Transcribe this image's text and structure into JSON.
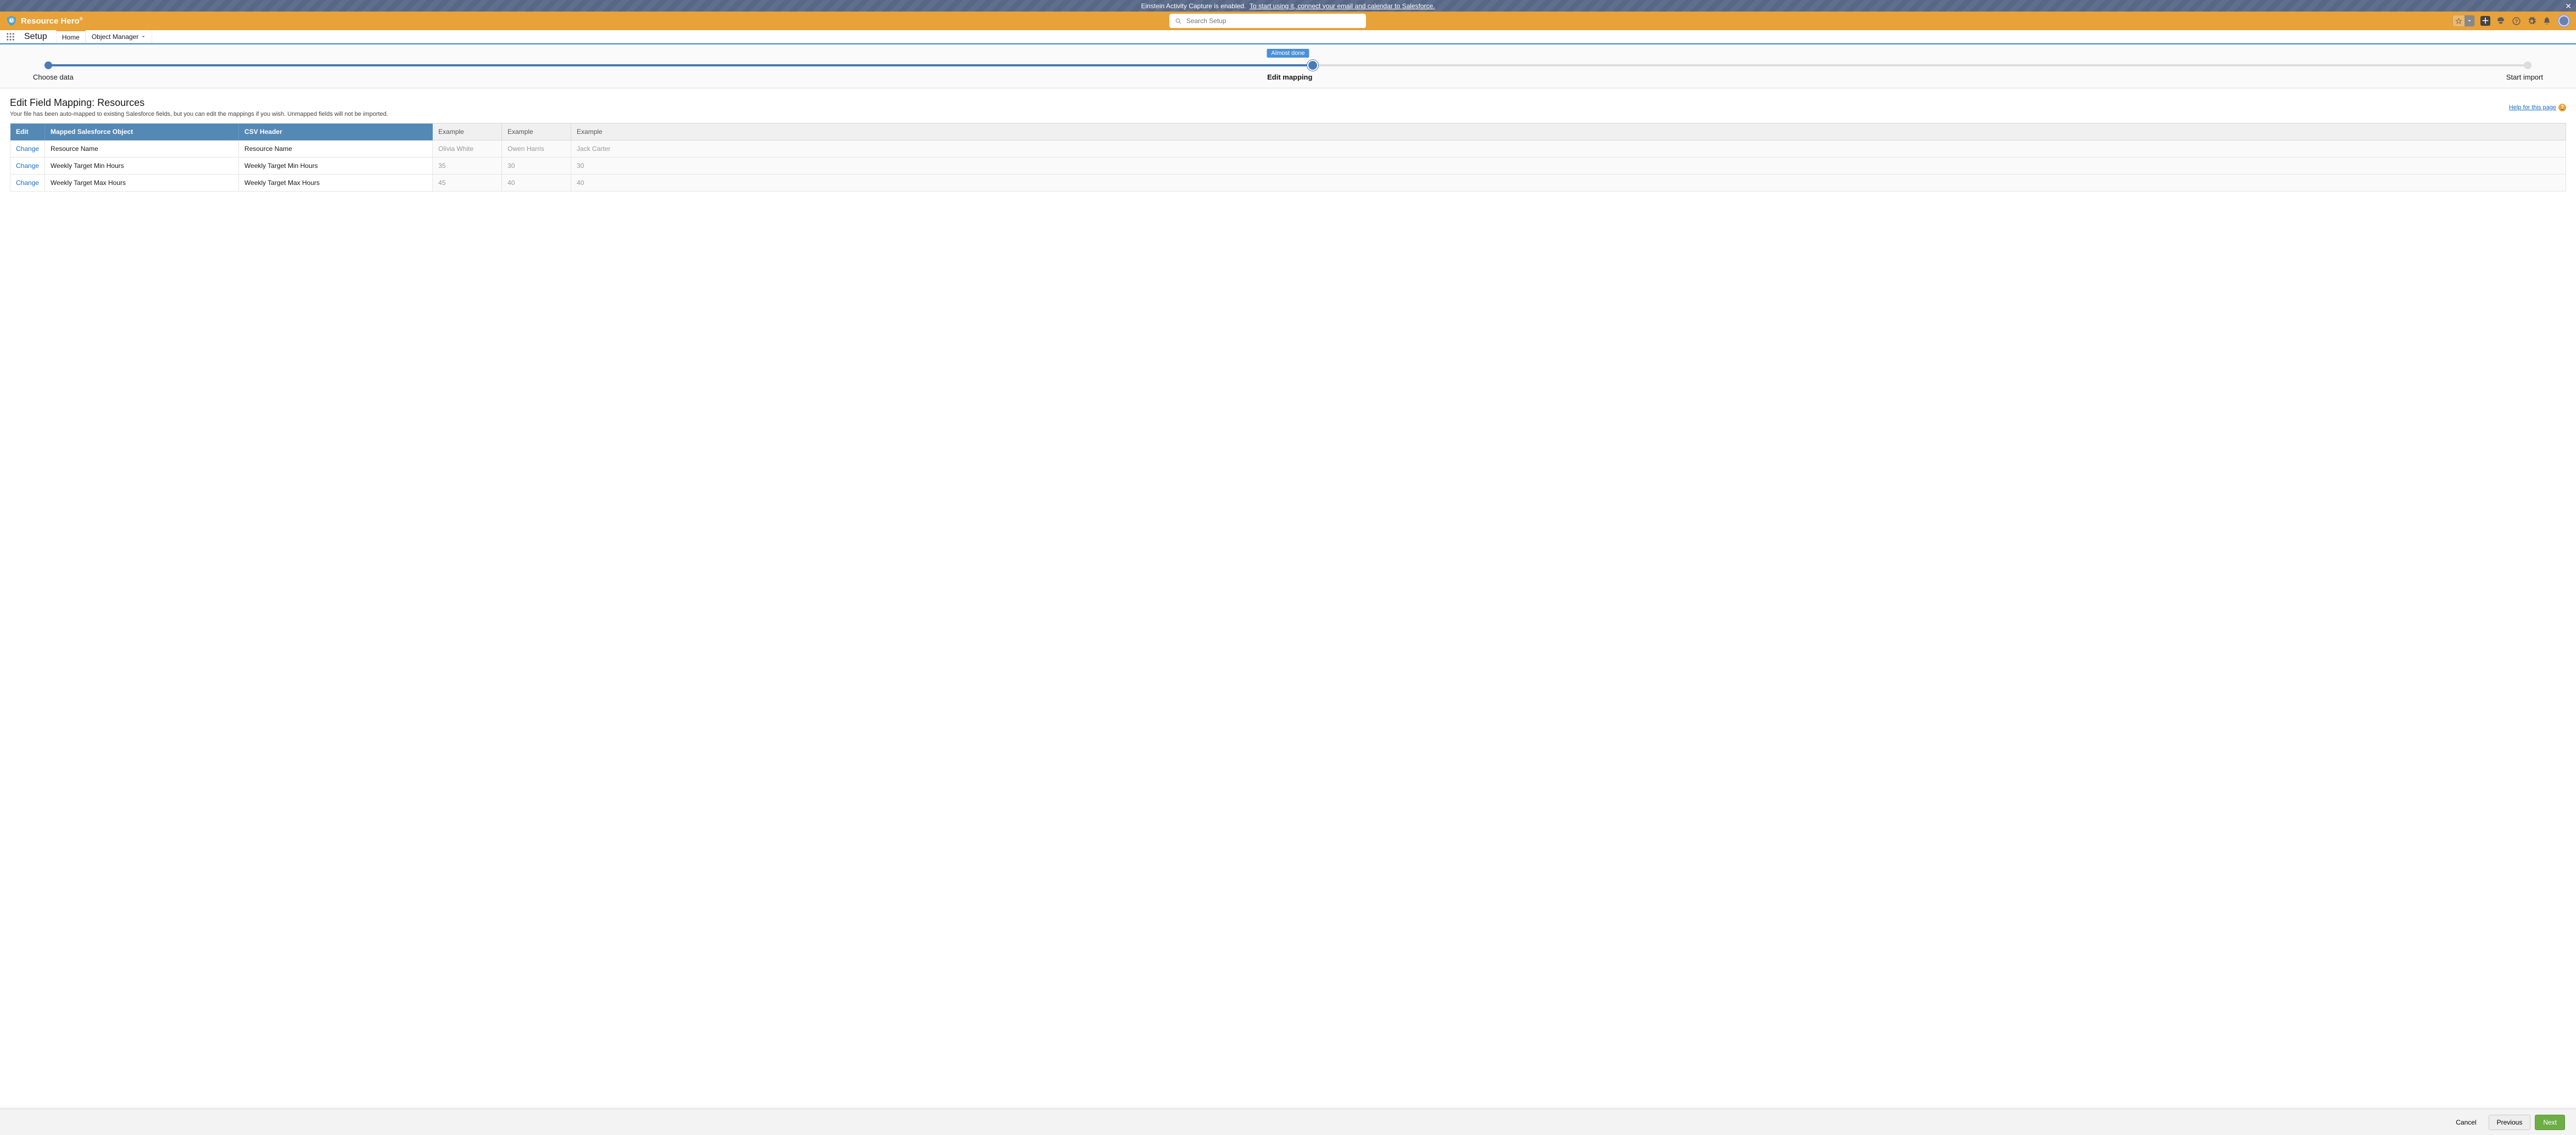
{
  "notif": {
    "text": "Einstein Activity Capture is enabled.",
    "link": "To start using it, connect your email and calendar to Salesforce."
  },
  "brand": {
    "name": "Resource Hero"
  },
  "search": {
    "placeholder": "Search Setup"
  },
  "nav": {
    "title": "Setup",
    "tabs": {
      "home": "Home",
      "obj": "Object Manager"
    }
  },
  "wizard": {
    "badge": "Almost done",
    "step1": "Choose data",
    "step2": "Edit mapping",
    "step3": "Start import"
  },
  "page": {
    "title": "Edit Field Mapping: Resources",
    "subtitle": "Your file has been auto-mapped to existing Salesforce fields, but you can edit the mappings if you wish. Unmapped fields will not be imported.",
    "help": "Help for this page"
  },
  "table": {
    "headers": {
      "edit": "Edit",
      "mapped": "Mapped Salesforce Object",
      "csv": "CSV Header",
      "ex1": "Example",
      "ex2": "Example",
      "ex3": "Example"
    },
    "change": "Change",
    "rows": [
      {
        "mapped": "Resource Name",
        "csv": "Resource Name",
        "ex": [
          "Olivia White",
          "Owen Harris",
          "Jack Carter"
        ]
      },
      {
        "mapped": "Weekly Target Min Hours",
        "csv": "Weekly Target Min Hours",
        "ex": [
          "35",
          "30",
          "30"
        ]
      },
      {
        "mapped": "Weekly Target Max Hours",
        "csv": "Weekly Target Max Hours",
        "ex": [
          "45",
          "40",
          "40"
        ]
      }
    ]
  },
  "footer": {
    "cancel": "Cancel",
    "prev": "Previous",
    "next": "Next"
  }
}
